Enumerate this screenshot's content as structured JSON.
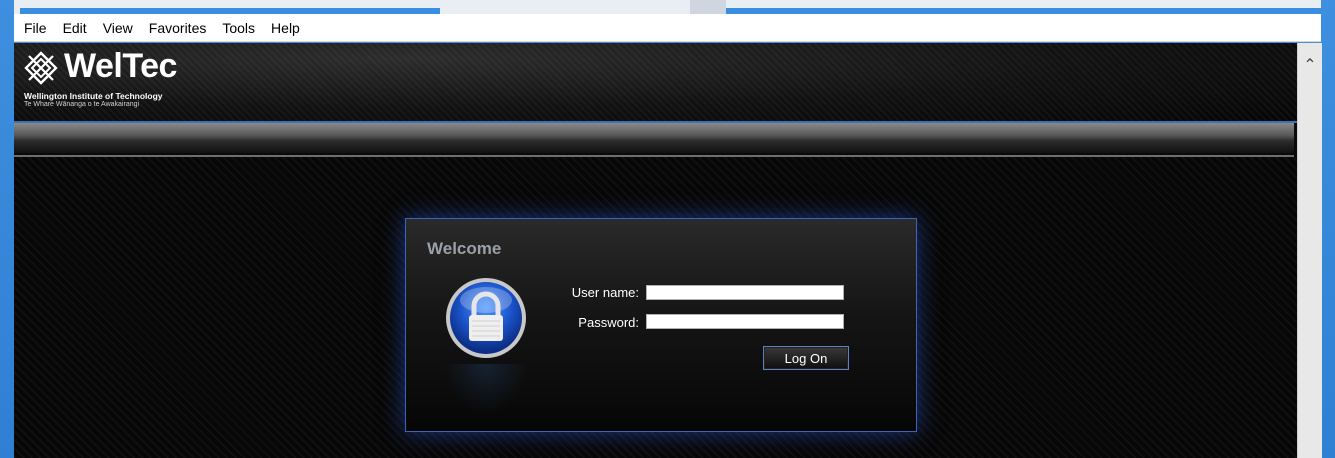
{
  "menu": {
    "items": [
      "File",
      "Edit",
      "View",
      "Favorites",
      "Tools",
      "Help"
    ]
  },
  "logo": {
    "name": "WelTec",
    "subtitle1": "Wellington Institute of Technology",
    "subtitle2": "Te Whare Wānanga o te Awakairangi"
  },
  "login": {
    "title": "Welcome",
    "username_label": "User name:",
    "password_label": "Password:",
    "username_value": "",
    "password_value": "",
    "logon_label": "Log On"
  },
  "colors": {
    "accent": "#3f63b8",
    "frame": "#3a8ee0"
  }
}
